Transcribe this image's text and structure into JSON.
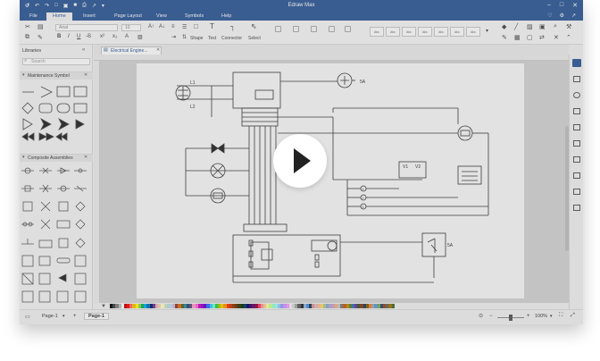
{
  "titlebar": {
    "title": "Edraw Max",
    "window_controls": [
      "minimize-icon",
      "maximize-icon",
      "close-icon"
    ]
  },
  "menubar": {
    "tabs": [
      "File",
      "Home",
      "Insert",
      "Page Layout",
      "View",
      "Symbols",
      "Help"
    ],
    "active_tab": "Home"
  },
  "ribbon": {
    "font_name": "Arial",
    "font_size": "10",
    "tools": [
      "Shape",
      "Text",
      "Connector",
      "Select"
    ],
    "style_label": "Abc"
  },
  "libraries": {
    "title": "Libraries",
    "search_placeholder": "Search",
    "sections": [
      "Maintenance Symbol",
      "Composite Assemblies"
    ]
  },
  "document": {
    "tab_label": "Electrical Engine...",
    "labels": {
      "l1": "L1",
      "l2": "L2",
      "a5_top": "5A",
      "a5_bottom": "5A",
      "v1": "V1",
      "v2": "V2",
      "n1": "1",
      "n2": "2",
      "n3": "3"
    }
  },
  "statusbar": {
    "page_selector": "Page-1",
    "page_tab": "Page-1",
    "zoom": "100%"
  },
  "colors": {
    "accent": "#2b5797",
    "overlay": "#808080"
  },
  "palette_colors": [
    "#000000",
    "#404040",
    "#7f7f7f",
    "#bfbfbf",
    "#ffffff",
    "#c00000",
    "#ff0000",
    "#ff6666",
    "#ffc000",
    "#ffff00",
    "#92d050",
    "#00b050",
    "#00b0f0",
    "#0070c0",
    "#002060",
    "#7030a0",
    "#e6b8b7",
    "#fcd5b4",
    "#ffffcc",
    "#d8e4bc",
    "#b7dee8",
    "#c5d9f1",
    "#ccc0da",
    "#963634",
    "#e26b0a",
    "#4f6228",
    "#31869b",
    "#1f497d",
    "#60497a",
    "#ff99cc",
    "#ff66cc",
    "#cc00cc",
    "#9900cc",
    "#6600cc",
    "#3366ff",
    "#33ccff",
    "#66ffcc",
    "#33cc33",
    "#99cc00",
    "#ffcc00",
    "#ff9900",
    "#ff3300",
    "#cc3300",
    "#993300",
    "#663300",
    "#333300",
    "#003300",
    "#003366",
    "#000066",
    "#330066",
    "#660066",
    "#990033",
    "#ff3366",
    "#ff9999",
    "#ffcc99",
    "#ffff99",
    "#ccff99",
    "#99ffcc",
    "#99ffff",
    "#99ccff",
    "#9999ff",
    "#cc99ff",
    "#ff99ff",
    "#f2f2f2",
    "#d9d9d9",
    "#a6a6a6",
    "#595959",
    "#262626",
    "#8db4e2",
    "#538dd5",
    "#16365c",
    "#da9694",
    "#e6b9b8",
    "#fabf8f",
    "#ffd966",
    "#a9d08e",
    "#8ea9db",
    "#b4a7d6",
    "#d5a6bd",
    "#f4b183",
    "#c9c9c9",
    "#7b7b7b",
    "#c65911",
    "#bf8f00",
    "#548235",
    "#2e75b6",
    "#7030a0",
    "#375623",
    "#833c0b",
    "#203864",
    "#7f6000",
    "#ed7d31",
    "#a5a5a5",
    "#5b9bd5",
    "#70ad47",
    "#264478",
    "#9e480e",
    "#636363",
    "#997300",
    "#43682b"
  ]
}
